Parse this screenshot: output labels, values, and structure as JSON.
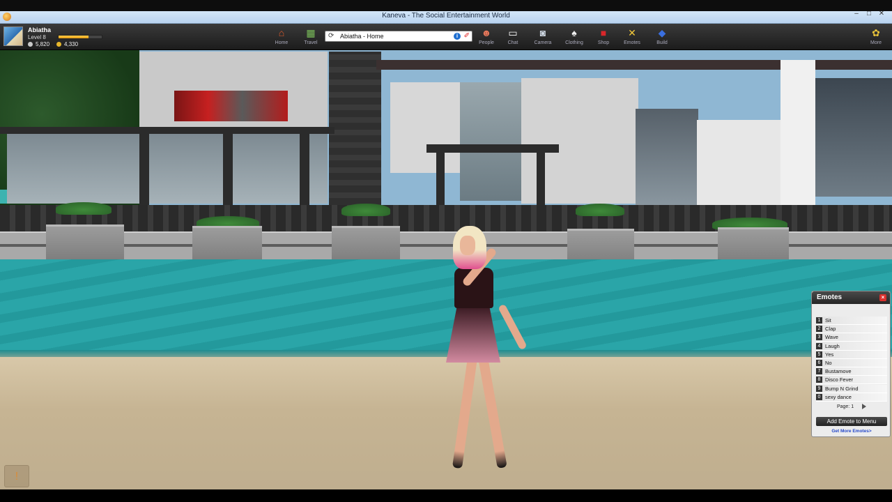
{
  "window": {
    "title": "Kaneva - The Social Entertainment World",
    "controls": [
      "–",
      "□",
      "✕"
    ]
  },
  "user": {
    "name": "Abiatha",
    "level": "Level 8",
    "level_progress_percent": 70,
    "rewards": "5,820",
    "credits": "4,330"
  },
  "toolbar": {
    "address": "Abiatha - Home",
    "items": [
      {
        "label": "Home",
        "icon": "house-icon",
        "glyph": "⌂",
        "color": "#e25b2a"
      },
      {
        "label": "Travel",
        "icon": "map-icon",
        "glyph": "▦",
        "color": "#7bbf5a"
      },
      {
        "label": "People",
        "icon": "people-icon",
        "glyph": "☻",
        "color": "#e4765a"
      },
      {
        "label": "Chat",
        "icon": "chat-bubble-icon",
        "glyph": "▭",
        "color": "#ffffff"
      },
      {
        "label": "Camera",
        "icon": "camera-icon",
        "glyph": "◙",
        "color": "#cfd8e3"
      },
      {
        "label": "Clothing",
        "icon": "shirt-icon",
        "glyph": "♠",
        "color": "#f0f0f0"
      },
      {
        "label": "Shop",
        "icon": "shop-box-icon",
        "glyph": "■",
        "color": "#d8262a"
      },
      {
        "label": "Emotes",
        "icon": "emotes-icon",
        "glyph": "✕",
        "color": "#f3c93a"
      },
      {
        "label": "Build",
        "icon": "build-blocks-icon",
        "glyph": "◆",
        "color": "#3a6fe0"
      },
      {
        "label": "More",
        "icon": "more-icon",
        "glyph": "✿",
        "color": "#e7c23a"
      }
    ]
  },
  "emotes_panel": {
    "title": "Emotes",
    "items": [
      {
        "num": "1",
        "label": "Sit"
      },
      {
        "num": "2",
        "label": "Clap"
      },
      {
        "num": "3",
        "label": "Wave"
      },
      {
        "num": "4",
        "label": "Laugh"
      },
      {
        "num": "5",
        "label": "Yes"
      },
      {
        "num": "6",
        "label": "No"
      },
      {
        "num": "7",
        "label": "Bustamove"
      },
      {
        "num": "8",
        "label": "Disco Fever"
      },
      {
        "num": "9",
        "label": "Bump N Grind"
      },
      {
        "num": "0",
        "label": "sexy dance"
      }
    ],
    "page_label": "Page: 1",
    "add_button": "Add Emote to Menu",
    "more_link": "Get More Emotes>"
  }
}
